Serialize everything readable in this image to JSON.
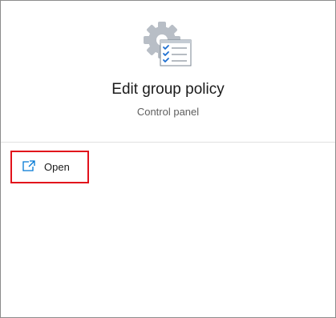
{
  "app": {
    "title": "Edit group policy",
    "subtitle": "Control panel",
    "icon": "group-policy-gear-checklist-icon"
  },
  "actions": [
    {
      "label": "Open",
      "icon": "open-in-new-window-icon",
      "highlighted": true
    }
  ],
  "colors": {
    "highlight": "#e2121b",
    "accent": "#0078d4",
    "gear": "#b8bec6"
  }
}
